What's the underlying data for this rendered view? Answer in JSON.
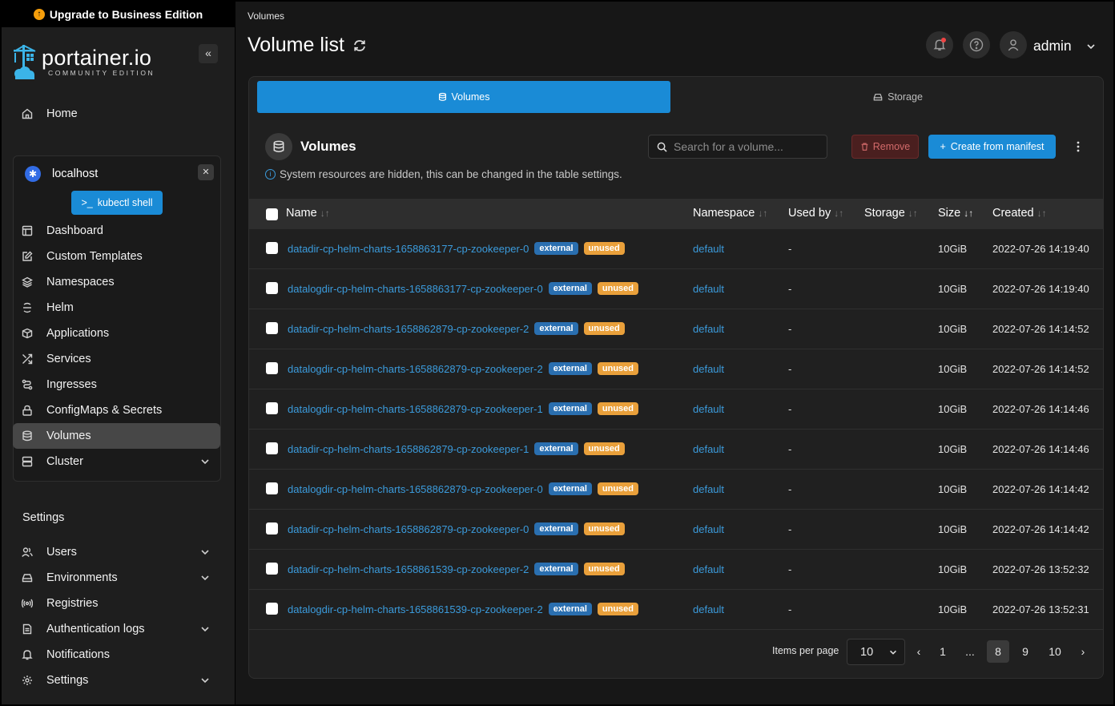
{
  "upgrade_banner": "Upgrade to Business Edition",
  "brand": {
    "name": "portainer.io",
    "edition": "COMMUNITY EDITION"
  },
  "nav": {
    "home": "Home"
  },
  "environment": {
    "name": "localhost",
    "kubectl_label": "kubectl shell",
    "items": [
      {
        "label": "Dashboard",
        "icon": "dashboard-icon"
      },
      {
        "label": "Custom Templates",
        "icon": "edit-icon"
      },
      {
        "label": "Namespaces",
        "icon": "layers-icon"
      },
      {
        "label": "Helm",
        "icon": "helm-icon"
      },
      {
        "label": "Applications",
        "icon": "box-icon"
      },
      {
        "label": "Services",
        "icon": "shuffle-icon"
      },
      {
        "label": "Ingresses",
        "icon": "route-icon"
      },
      {
        "label": "ConfigMaps & Secrets",
        "icon": "lock-icon"
      },
      {
        "label": "Volumes",
        "icon": "database-icon"
      },
      {
        "label": "Cluster",
        "icon": "server-icon"
      }
    ]
  },
  "settings": {
    "title": "Settings",
    "items": [
      {
        "label": "Users",
        "icon": "users-icon"
      },
      {
        "label": "Environments",
        "icon": "hard-drive-icon"
      },
      {
        "label": "Registries",
        "icon": "radio-icon"
      },
      {
        "label": "Authentication logs",
        "icon": "file-text-icon"
      },
      {
        "label": "Notifications",
        "icon": "bell-icon"
      },
      {
        "label": "Settings",
        "icon": "gear-icon"
      }
    ]
  },
  "header": {
    "breadcrumb": "Volumes",
    "title": "Volume list",
    "user": "admin"
  },
  "tabs": {
    "volumes": "Volumes",
    "storage": "Storage"
  },
  "table": {
    "title": "Volumes",
    "search_placeholder": "Search for a volume...",
    "remove_label": "Remove",
    "create_label": "Create from manifest",
    "info": "System resources are hidden, this can be changed in the table settings.",
    "columns": {
      "name": "Name",
      "namespace": "Namespace",
      "used_by": "Used by",
      "storage": "Storage",
      "size": "Size",
      "created": "Created"
    },
    "rows": [
      {
        "name": "datadir-cp-helm-charts-1658863177-cp-zookeeper-0",
        "badge1": "external",
        "badge2": "unused",
        "namespace": "default",
        "used_by": "-",
        "size": "10GiB",
        "created": "2022-07-26 14:19:40"
      },
      {
        "name": "datalogdir-cp-helm-charts-1658863177-cp-zookeeper-0",
        "badge1": "external",
        "badge2": "unused",
        "namespace": "default",
        "used_by": "-",
        "size": "10GiB",
        "created": "2022-07-26 14:19:40"
      },
      {
        "name": "datadir-cp-helm-charts-1658862879-cp-zookeeper-2",
        "badge1": "external",
        "badge2": "unused",
        "namespace": "default",
        "used_by": "-",
        "size": "10GiB",
        "created": "2022-07-26 14:14:52"
      },
      {
        "name": "datalogdir-cp-helm-charts-1658862879-cp-zookeeper-2",
        "badge1": "external",
        "badge2": "unused",
        "namespace": "default",
        "used_by": "-",
        "size": "10GiB",
        "created": "2022-07-26 14:14:52"
      },
      {
        "name": "datalogdir-cp-helm-charts-1658862879-cp-zookeeper-1",
        "badge1": "external",
        "badge2": "unused",
        "namespace": "default",
        "used_by": "-",
        "size": "10GiB",
        "created": "2022-07-26 14:14:46"
      },
      {
        "name": "datadir-cp-helm-charts-1658862879-cp-zookeeper-1",
        "badge1": "external",
        "badge2": "unused",
        "namespace": "default",
        "used_by": "-",
        "size": "10GiB",
        "created": "2022-07-26 14:14:46"
      },
      {
        "name": "datalogdir-cp-helm-charts-1658862879-cp-zookeeper-0",
        "badge1": "external",
        "badge2": "unused",
        "namespace": "default",
        "used_by": "-",
        "size": "10GiB",
        "created": "2022-07-26 14:14:42"
      },
      {
        "name": "datadir-cp-helm-charts-1658862879-cp-zookeeper-0",
        "badge1": "external",
        "badge2": "unused",
        "namespace": "default",
        "used_by": "-",
        "size": "10GiB",
        "created": "2022-07-26 14:14:42"
      },
      {
        "name": "datadir-cp-helm-charts-1658861539-cp-zookeeper-2",
        "badge1": "external",
        "badge2": "unused",
        "namespace": "default",
        "used_by": "-",
        "size": "10GiB",
        "created": "2022-07-26 13:52:32"
      },
      {
        "name": "datalogdir-cp-helm-charts-1658861539-cp-zookeeper-2",
        "badge1": "external",
        "badge2": "unused",
        "namespace": "default",
        "used_by": "-",
        "size": "10GiB",
        "created": "2022-07-26 13:52:31"
      }
    ]
  },
  "pagination": {
    "items_per_page_label": "Items per page",
    "items_per_page": "10",
    "prev": "‹",
    "next": "›",
    "pages": [
      "1",
      "...",
      "8",
      "9",
      "10"
    ],
    "current": "8"
  },
  "colors": {
    "accent": "#1a8bd6",
    "link": "#3b9bdc",
    "external_badge": "#2a6fb0",
    "unused_badge": "#e9a03b"
  }
}
